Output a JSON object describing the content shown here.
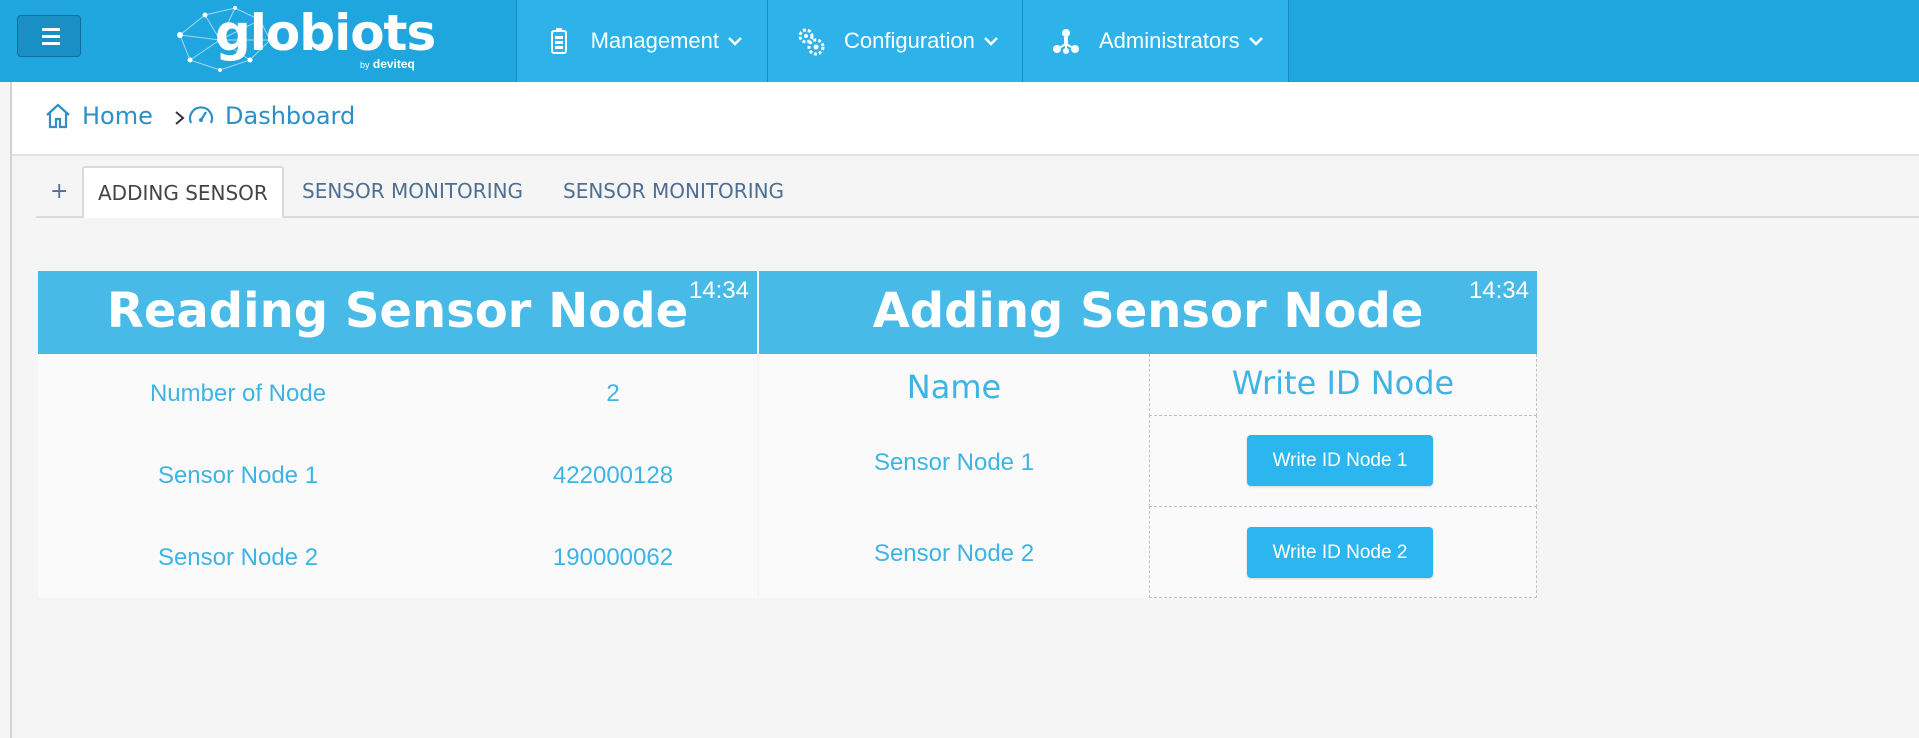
{
  "header": {
    "logo_text": "globiots",
    "logo_sub_by": "by",
    "logo_sub_brand": "deviteq",
    "nav": [
      {
        "label": "Management",
        "icon": "battery-icon"
      },
      {
        "label": "Configuration",
        "icon": "gears-icon"
      },
      {
        "label": "Administrators",
        "icon": "network-icon"
      }
    ]
  },
  "breadcrumb": {
    "home": "Home",
    "dashboard": "Dashboard"
  },
  "tabs": {
    "plus": "+",
    "items": [
      "ADDING SENSOR",
      "SENSOR MONITORING",
      "SENSOR MONITORING"
    ],
    "active_index": 0
  },
  "reading_panel": {
    "title": "Reading Sensor Node",
    "time": "14:34",
    "rows": [
      {
        "label": "Number of Node",
        "value": "2"
      },
      {
        "label": "Sensor Node 1",
        "value": "422000128"
      },
      {
        "label": "Sensor Node 2",
        "value": "190000062"
      }
    ]
  },
  "adding_panel": {
    "title": "Adding Sensor Node",
    "time": "14:34",
    "col_name": "Name",
    "col_write": "Write ID Node",
    "rows": [
      {
        "name": "Sensor Node 1",
        "button": "Write ID Node 1"
      },
      {
        "name": "Sensor Node 2",
        "button": "Write ID Node 2"
      }
    ]
  },
  "colors": {
    "topbar": "#1fa6de",
    "nav_item": "#2db3e9",
    "panel_header": "#47bae7",
    "text_accent": "#3eb4e4",
    "button": "#2cb6f0"
  }
}
